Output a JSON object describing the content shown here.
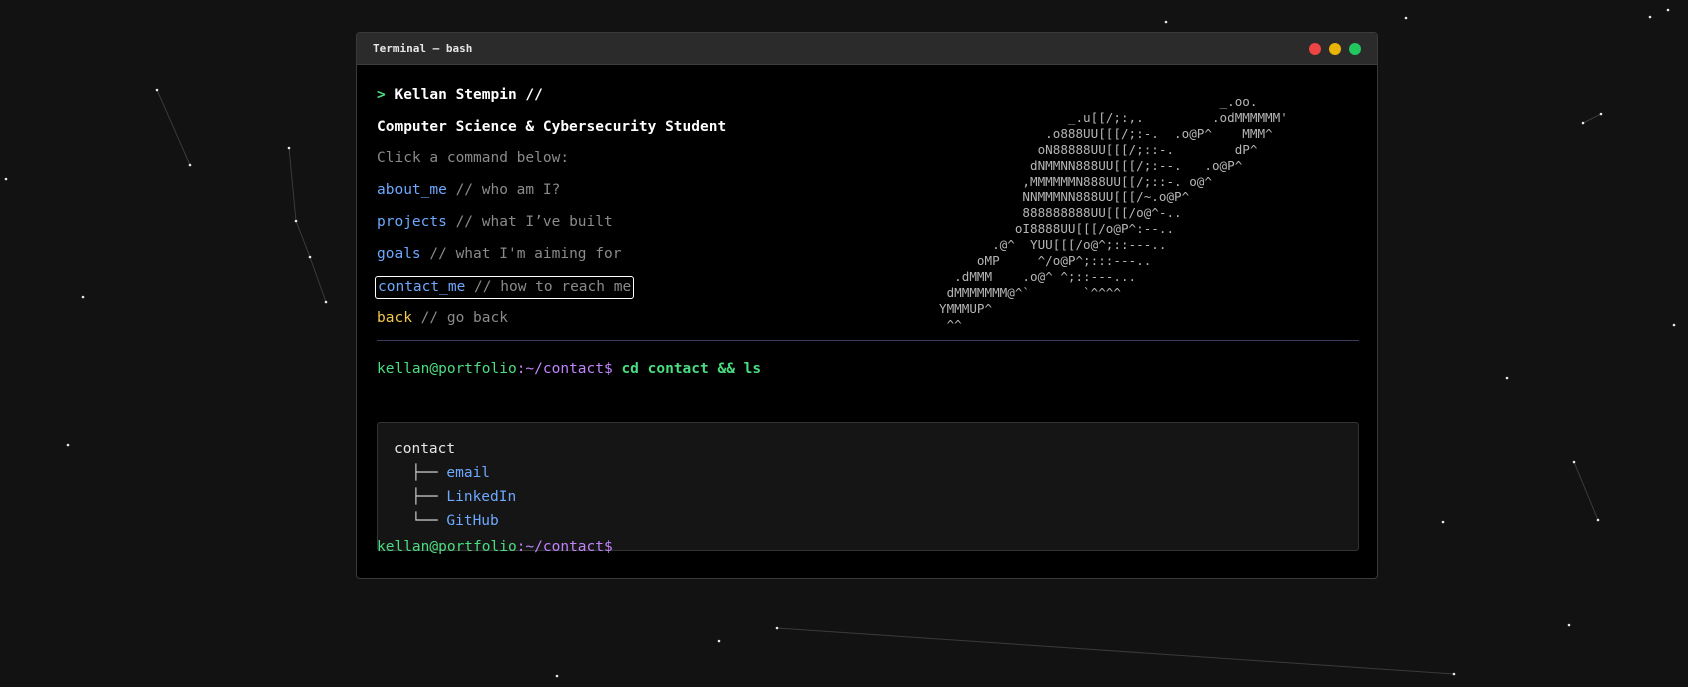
{
  "window": {
    "title": "Terminal — bash",
    "controls": [
      "close",
      "minimize",
      "maximize"
    ],
    "control_colors": {
      "close": "#ef4444",
      "minimize": "#eab308",
      "maximize": "#22c55e"
    }
  },
  "header": {
    "prompt_symbol": ">",
    "name": "Kellan Stempin //",
    "subtitle": "Computer Science & Cybersecurity Student",
    "hint": "Click a command below:"
  },
  "menu": [
    {
      "cmd": "about_me",
      "comment": "// who am I?"
    },
    {
      "cmd": "projects",
      "comment": "// what I’ve built"
    },
    {
      "cmd": "goals",
      "comment": "// what I'm aiming for"
    },
    {
      "cmd": "contact_me",
      "comment": "// how to reach me"
    },
    {
      "cmd": "back",
      "comment": "// go back"
    }
  ],
  "ascii_art": "                                     _.oo.\n                 _.u[[/;:,.         .odMMMMMM'\n              .o888UU[[[/;:-.  .o@P^    MMM^\n             oN88888UU[[[/;::-.        dP^\n            dNMMNN888UU[[[/;:--.   .o@P^\n           ,MMMMMMN888UU[[/;::-. o@^\n           NNMMMNN888UU[[[/~.o@P^\n           888888888UU[[[/o@^-..\n          oI8888UU[[[/o@P^:--..\n       .@^  YUU[[[/o@^;::---..\n     oMP     ^/o@P^;:::---..\n  .dMMM    .o@^ ^;::---...\n dMMMMMMM@^`       `^^^^\nYMMMUP^\n ^^",
  "shell": {
    "user": "kellan@portfolio",
    "path": ":~/contact$",
    "command": " cd contact && ls",
    "prompt2_user": "kellan@portfolio",
    "prompt2_path": ":~/contact$"
  },
  "tree": {
    "root": "contact",
    "items": [
      {
        "branch": "  ├── ",
        "label": "email"
      },
      {
        "branch": "  ├── ",
        "label": "LinkedIn"
      },
      {
        "branch": "  └── ",
        "label": "GitHub"
      }
    ]
  }
}
